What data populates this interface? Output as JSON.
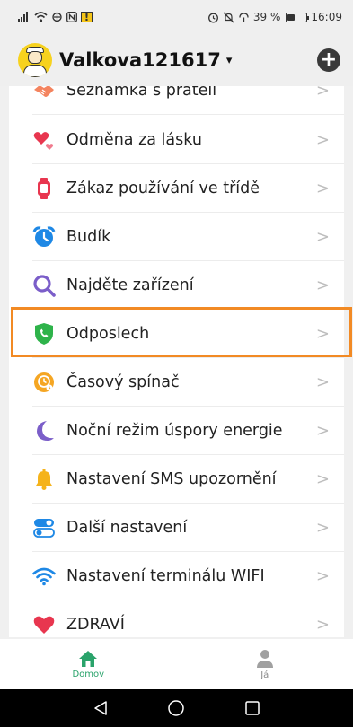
{
  "status_bar": {
    "left_icons": [
      "signal-icon",
      "wifi-icon",
      "sync-icon",
      "nfc-icon",
      "warning-icon"
    ],
    "right_icons": [
      "alarm-icon",
      "mute-icon",
      "data-icon"
    ],
    "battery_text": "39 %",
    "battery_level": 0.39,
    "time": "16:09"
  },
  "header": {
    "username": "Valkova121617",
    "dropdown_glyph": "▾",
    "add_glyph": "+"
  },
  "menu": {
    "items": [
      {
        "label": "Seznamka s přáteli",
        "icon": "handshake-icon",
        "color": "#f4845f"
      },
      {
        "label": "Odměna za lásku",
        "icon": "hearts-icon",
        "color": "#e8364f"
      },
      {
        "label": "Zákaz používání ve třídě",
        "icon": "watch-icon",
        "color": "#e8364f"
      },
      {
        "label": "Budík",
        "icon": "alarm-clock-icon",
        "color": "#1e88e5"
      },
      {
        "label": "Najděte zařízení",
        "icon": "magnifier-icon",
        "color": "#7b5ec9"
      },
      {
        "label": "Odposlech",
        "icon": "phone-shield-icon",
        "color": "#2eb34a"
      },
      {
        "label": "Časový spínač",
        "icon": "timer-icon",
        "color": "#f5a623"
      },
      {
        "label": "Noční režim úspory energie",
        "icon": "moon-icon",
        "color": "#7b5ec9"
      },
      {
        "label": "Nastavení SMS upozornění",
        "icon": "bell-icon",
        "color": "#f5b31b"
      },
      {
        "label": "Další nastavení",
        "icon": "toggle-settings-icon",
        "color": "#1e88e5"
      },
      {
        "label": "Nastavení terminálu WIFI",
        "icon": "wifi-signal-icon",
        "color": "#1e88e5"
      },
      {
        "label": "ZDRAVÍ",
        "icon": "heart-icon",
        "color": "#e8364f"
      }
    ],
    "chevron": ">",
    "highlighted_index": 5
  },
  "tabs": [
    {
      "label": "Domov",
      "icon": "home-icon",
      "active": true
    },
    {
      "label": "Já",
      "icon": "person-icon",
      "active": false
    }
  ],
  "nav_bar": {
    "icons": [
      "back-icon",
      "home-circle-icon",
      "recents-icon"
    ]
  },
  "colors": {
    "accent": "#2aa36b",
    "highlight": "#f28a24"
  }
}
